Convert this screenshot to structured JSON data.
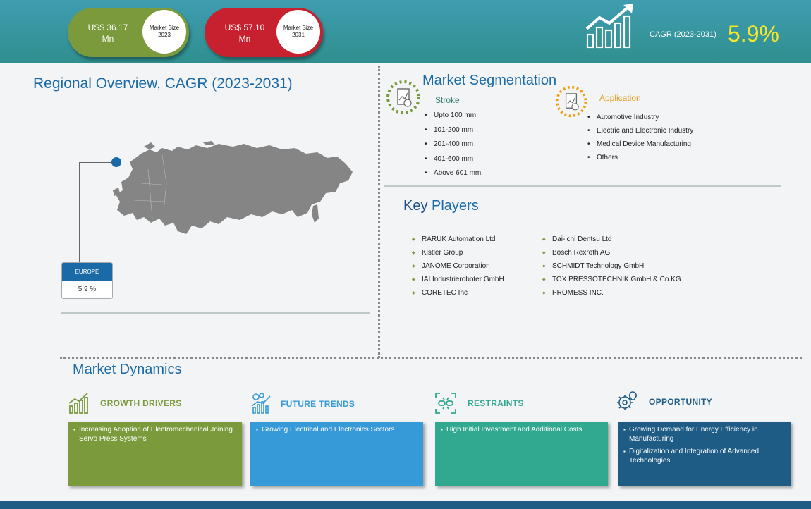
{
  "header": {
    "market_2023": {
      "value": "US$ 36.17",
      "unit": "Mn",
      "label_line1": "Market Size",
      "label_line2": "2023"
    },
    "market_2031": {
      "value": "US$ 57.10",
      "unit": "Mn",
      "label_line1": "Market Size",
      "label_line2": "2031"
    },
    "cagr_label": "CAGR (2023-2031)",
    "cagr_value": "5.9%",
    "colors": {
      "header": "#3f9db0",
      "pill_2023": "#7a9a3c",
      "pill_2031": "#c7202e",
      "cagr_value": "#f5e62a"
    }
  },
  "regional": {
    "title": "Regional Overview, CAGR (2023-2031)",
    "region_name": "EUROPE",
    "region_cagr": "5.9 %",
    "icons": [
      "europe-map-icon",
      "location-pin-icon"
    ]
  },
  "segmentation": {
    "title": "Market Segmentation",
    "stroke": {
      "heading": "Stroke",
      "icon": "document-chart-icon",
      "items": [
        "Upto 100 mm",
        "101-200 mm",
        "201-400 mm",
        "401-600 mm",
        "Above 601 mm"
      ]
    },
    "application": {
      "heading": "Application",
      "icon": "document-chart-icon",
      "items": [
        "Automotive Industry",
        "Electric and Electronic Industry",
        "Medical Device Manufacturing",
        "Others"
      ]
    }
  },
  "key_players": {
    "title_bold": "Key",
    "title_rest": " Players",
    "left": [
      "RARUK Automation Ltd",
      "Kistler Group",
      "JANOME Corporation",
      "IAI Industrieroboter GmbH",
      "CORETEC Inc"
    ],
    "right": [
      "Dai-ichi Dentsu Ltd",
      "Bosch Rexroth AG",
      "SCHMIDT Technology GmbH",
      "TOX PRESSOTECHNIK GmbH & Co.KG",
      "PROMESS INC."
    ]
  },
  "dynamics": {
    "title": "Market Dynamics",
    "drivers": {
      "heading": "GROWTH DRIVERS",
      "icon": "bar-chart-growth-icon",
      "color": "#7a9a3c",
      "items": [
        "Increasing Adoption of Electromechanical Joining Servo Press Systems"
      ]
    },
    "trends": {
      "heading": "FUTURE TRENDS",
      "icon": "gears-chart-icon",
      "color": "#3699d8",
      "items": [
        "Growing Electrical and Electronics Sectors"
      ]
    },
    "restraints": {
      "heading": "RESTRAINTS",
      "icon": "broken-chain-icon",
      "color": "#31a890",
      "items": [
        "High Initial Investment and Additional Costs"
      ]
    },
    "opportunity": {
      "heading": "OPPORTUNITY",
      "icon": "gear-bulb-icon",
      "color": "#1f5c85",
      "items": [
        "Growing Demand for Energy Efficiency in Manufacturing",
        "Digitalization and Integration of Advanced Technologies"
      ]
    }
  }
}
